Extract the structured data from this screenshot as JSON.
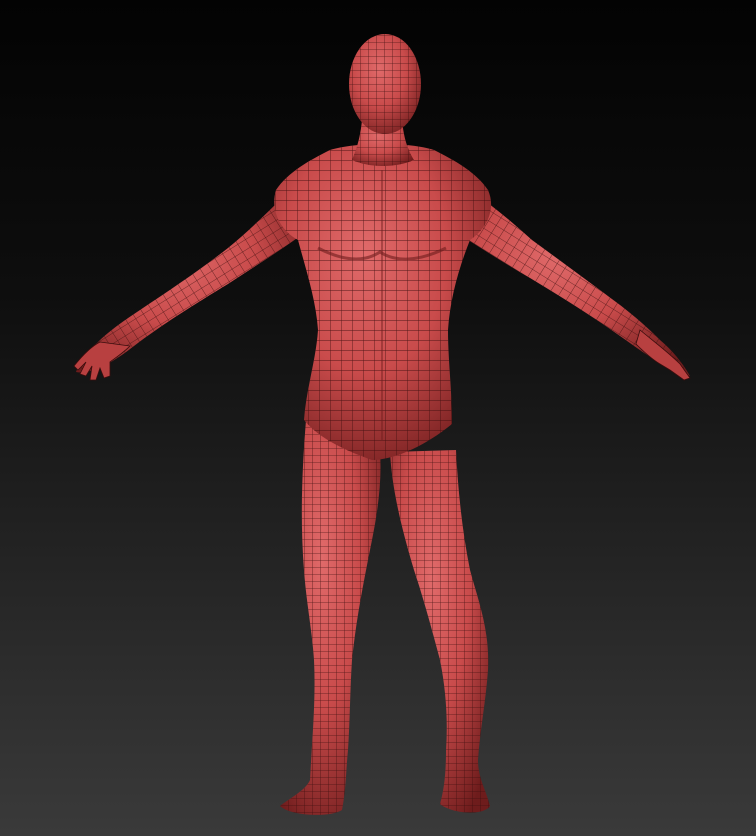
{
  "viewport": {
    "background_top": "#030303",
    "background_bottom": "#3a3a3a",
    "top_rule_color": "#6a6a6a"
  },
  "model": {
    "subject": "humanoid-base-mesh",
    "pose": "A-pose",
    "material_color": "#c94b4b",
    "material_highlight": "#e06a6a",
    "material_shadow": "#6e1c1c",
    "wireframe_color": "#3a0d0d",
    "wireframe_visible": true
  }
}
